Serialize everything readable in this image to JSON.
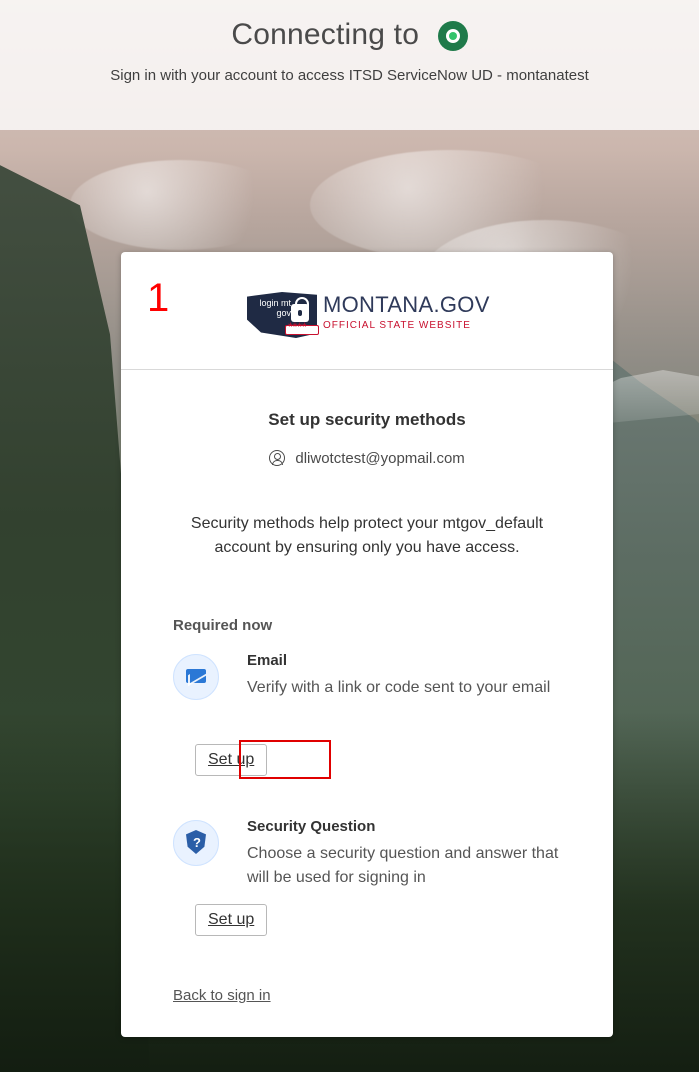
{
  "banner": {
    "title": "Connecting to",
    "subtitle": "Sign in with your account to access ITSD ServiceNow UD - montanatest"
  },
  "annotation": {
    "step_number": "1"
  },
  "org_logo": {
    "login_text": "login mt gov",
    "name": "MONTANA.GOV",
    "tagline": "OFFICIAL STATE WEBSITE"
  },
  "security_setup": {
    "title": "Set up security methods",
    "user_email": "dliwotctest@yopmail.com",
    "info": "Security methods help protect your mtgov_default account by ensuring only you have access.",
    "required_heading": "Required now",
    "methods": [
      {
        "name": "Email",
        "description": "Verify with a link or code sent to your email",
        "button": "Set up",
        "icon": "mail-icon"
      },
      {
        "name": "Security Question",
        "description": "Choose a security question and answer that will be used for signing in",
        "button": "Set up",
        "icon": "shield-question-icon"
      }
    ],
    "back_link": "Back to sign in"
  },
  "colors": {
    "accent_red": "#e00000",
    "logo_navy": "#1f2a44",
    "link_gray": "#555555",
    "icon_blue": "#2b78d6"
  }
}
